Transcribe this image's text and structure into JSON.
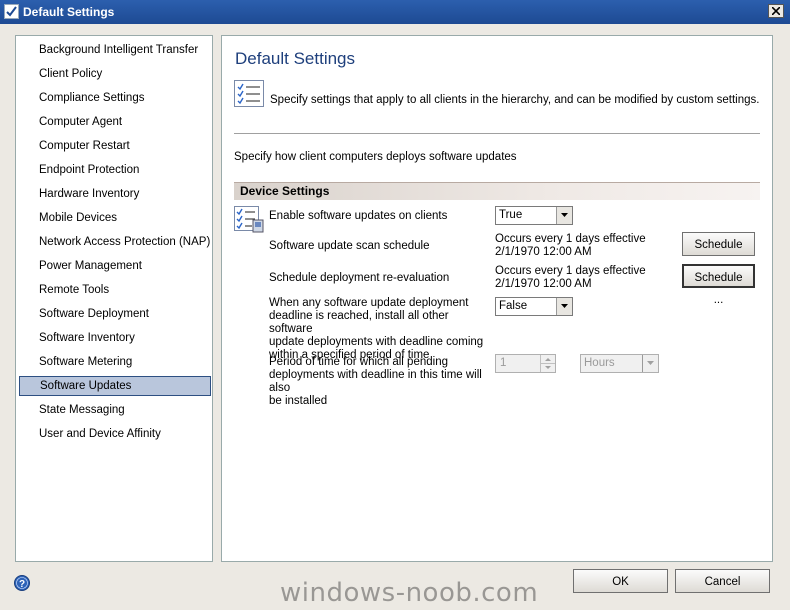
{
  "window": {
    "title": "Default Settings"
  },
  "sidebar": {
    "items": [
      "Background Intelligent Transfer",
      "Client Policy",
      "Compliance Settings",
      "Computer Agent",
      "Computer Restart",
      "Endpoint Protection",
      "Hardware Inventory",
      "Mobile Devices",
      "Network Access Protection (NAP)",
      "Power Management",
      "Remote Tools",
      "Software Deployment",
      "Software Inventory",
      "Software Metering",
      "Software Updates",
      "State Messaging",
      "User and Device Affinity"
    ],
    "selected_index": 14
  },
  "main": {
    "title": "Default Settings",
    "description": "Specify settings that apply to all clients in the hierarchy, and can be modified by custom settings.",
    "subtitle": "Specify how client computers deploys software updates",
    "section_header": "Device Settings",
    "settings": {
      "enable_updates": {
        "label": "Enable software updates on clients",
        "value": "True"
      },
      "scan_schedule": {
        "label": "Software update scan schedule",
        "value_line1": "Occurs every 1 days effective",
        "value_line2": "2/1/1970 12:00 AM",
        "button": "Schedule ..."
      },
      "reeval_schedule": {
        "label": "Schedule deployment re-evaluation",
        "value_line1": "Occurs every 1 days effective",
        "value_line2": "2/1/1970 12:00 AM",
        "button": "Schedule ..."
      },
      "deadline_install": {
        "label_lines": [
          "When any software update deployment",
          "deadline is reached, install all other software",
          "update deployments with deadline coming",
          "within a specified period of time"
        ],
        "value": "False"
      },
      "period": {
        "label_lines": [
          "Period of time for which all pending",
          "deployments with deadline in this time will also",
          "be installed"
        ],
        "number": "1",
        "unit": "Hours"
      }
    }
  },
  "footer": {
    "ok_label": "OK",
    "cancel_label": "Cancel",
    "watermark": "windows-noob.com"
  },
  "colors": {
    "title_accent": "#1e3f7c",
    "selected_bg": "#b9c6dc",
    "titlebar": "#2c5fae"
  }
}
